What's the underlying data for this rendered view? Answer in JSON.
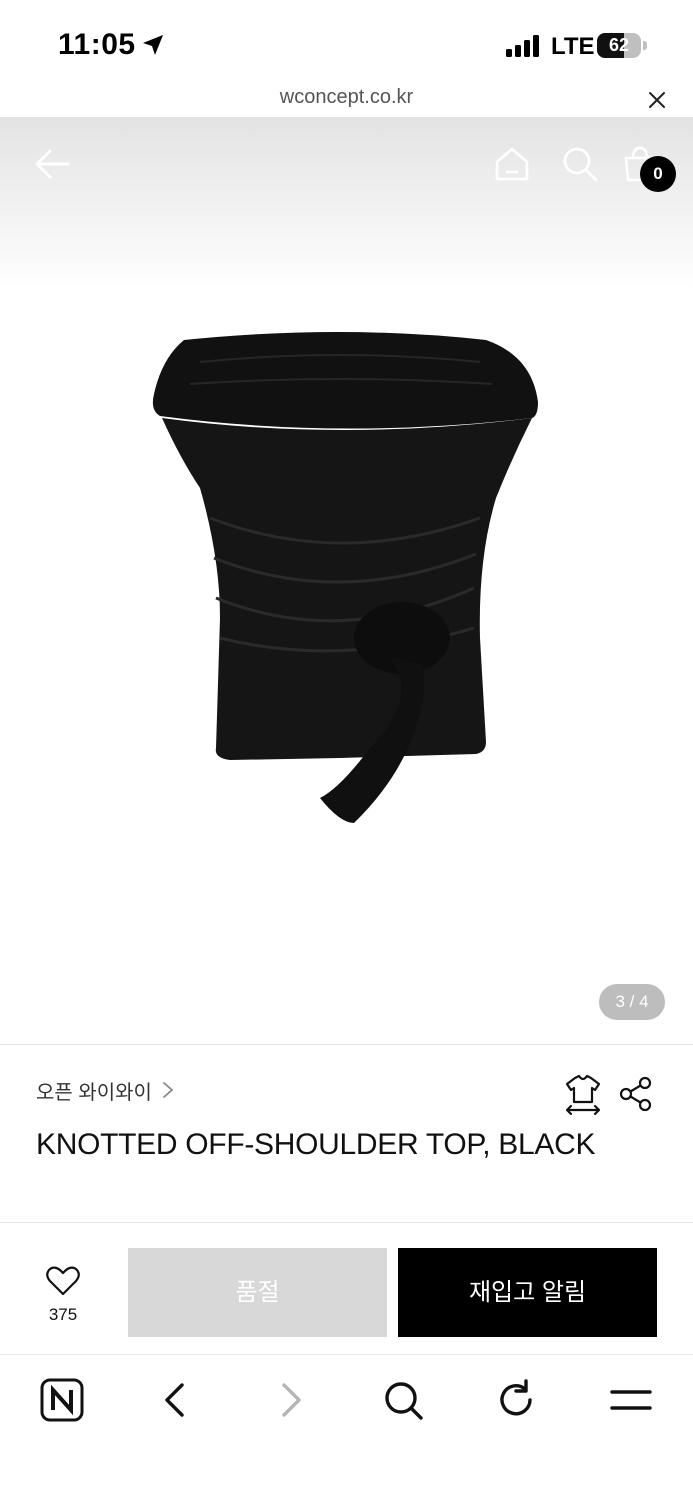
{
  "status_bar": {
    "time": "11:05",
    "network": "LTE",
    "battery_level": "62",
    "battery_fraction": 0.62
  },
  "browser": {
    "url": "wconcept.co.kr"
  },
  "header": {
    "cart_count": "0"
  },
  "gallery": {
    "indicator": "3 / 4"
  },
  "product": {
    "brand": "오픈 와이와이",
    "title": "KNOTTED OFF-SHOULDER TOP, BLACK"
  },
  "actions": {
    "wishlist_count": "375",
    "soldout_label": "품절",
    "restock_label": "재입고 알림"
  },
  "icons": {
    "status": [
      "location-arrow-icon",
      "signal-icon",
      "battery-icon"
    ],
    "header": [
      "back-arrow-icon",
      "home-icon",
      "search-icon",
      "cart-icon"
    ],
    "product": [
      "chevron-right-icon",
      "size-guide-icon",
      "share-icon",
      "heart-icon"
    ],
    "toolbar": [
      "naver-icon",
      "back-icon",
      "forward-icon",
      "search-icon",
      "reload-icon",
      "menu-icon"
    ]
  },
  "colors": {
    "primary_button": "#000000",
    "disabled_button": "#d8d8d8",
    "indicator_bg": "#bdbdbd"
  }
}
